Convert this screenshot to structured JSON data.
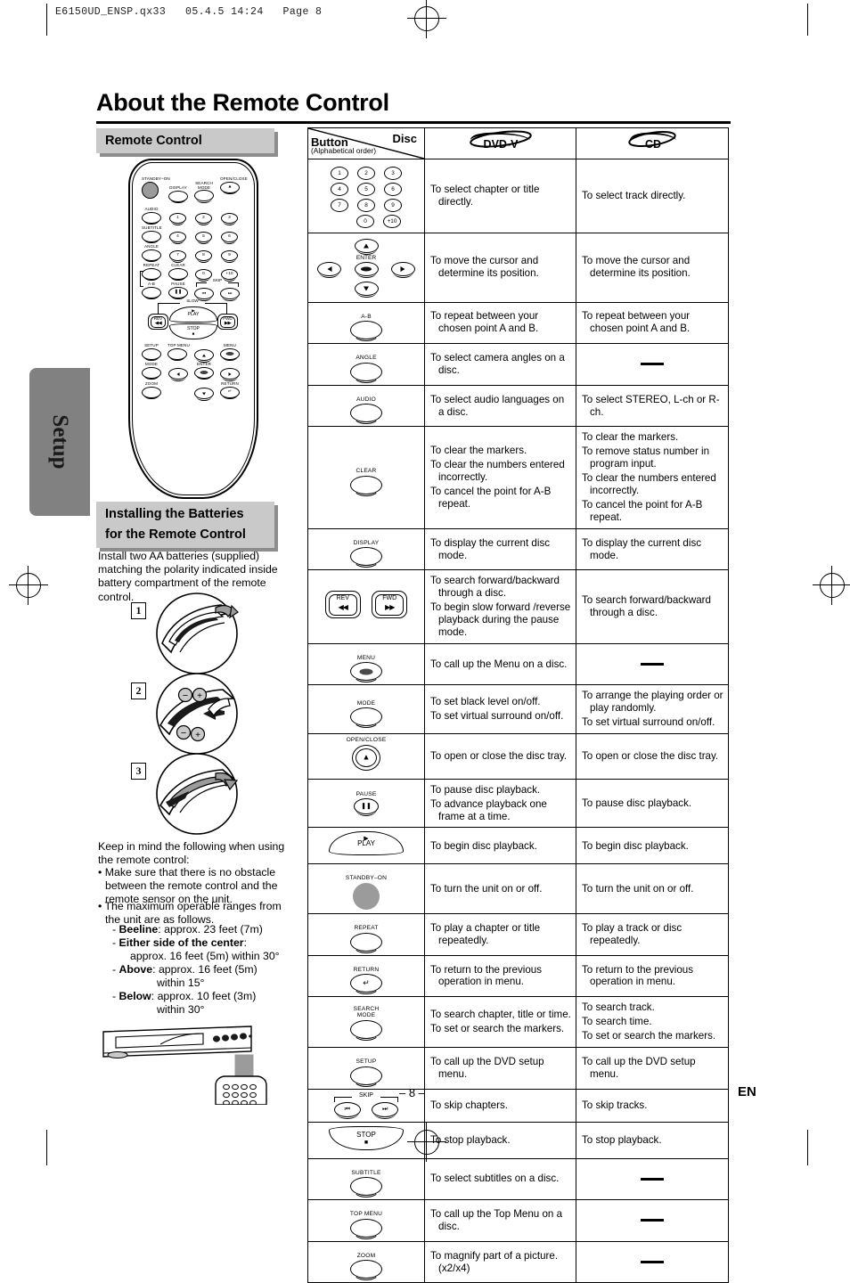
{
  "meta": {
    "file_stamp": "E6150UD_ENSP.qx33   05.4.5 14:24   Page 8",
    "page_number": "– 8 –",
    "language_code": "EN",
    "side_tab": "Setup"
  },
  "page_title": "About the Remote Control",
  "sections": {
    "remote_control": "Remote Control",
    "installing_batteries_line1": "Installing the Batteries",
    "installing_batteries_line2": "for the Remote Control"
  },
  "battery_instructions": {
    "intro": "Install two AA batteries (supplied) matching the polarity indicated inside battery compartment of the remote control.",
    "steps": [
      "1",
      "2",
      "3"
    ]
  },
  "keep_in_mind": {
    "heading": "Keep in mind the following when using the remote control:",
    "bullets": [
      "Make sure that there is no obstacle between the remote control and the remote sensor on the unit.",
      "The maximum operable ranges from the unit are as follows."
    ],
    "ranges": [
      {
        "label": "Beeline",
        "value": ": approx. 23 feet (7m)"
      },
      {
        "label": "Either side of the center",
        "value": ":",
        "value2": "approx. 16 feet (5m) within 30°"
      },
      {
        "label": "Above",
        "value": ":  approx. 16 feet (5m)",
        "value2": "within 15°"
      },
      {
        "label": "Below",
        "value": ":  approx. 10 feet (3m)",
        "value2": "within 30°"
      }
    ]
  },
  "table": {
    "header": {
      "button": "Button",
      "button_sub": "(Alphabetical order)",
      "disc": "Disc",
      "dvd_logo": "DVD-V",
      "cd_logo": "CD"
    },
    "rows": [
      {
        "key": "numbers",
        "key_label": "",
        "dvd": [
          "To select chapter or title directly."
        ],
        "cd": [
          "To select track directly."
        ]
      },
      {
        "key": "cursor-enter",
        "key_label": "ENTER",
        "dvd": [
          "To move the cursor and determine its position."
        ],
        "cd": [
          "To move the cursor and determine its position."
        ]
      },
      {
        "key": "a-b",
        "key_label": "A-B",
        "dvd": [
          "To repeat between your chosen point A and B."
        ],
        "cd": [
          "To repeat between your chosen point A and B."
        ]
      },
      {
        "key": "angle",
        "key_label": "ANGLE",
        "dvd": [
          "To select camera angles on a disc."
        ],
        "cd": []
      },
      {
        "key": "audio",
        "key_label": "AUDIO",
        "dvd": [
          "To select audio languages on a disc."
        ],
        "cd": [
          "To select STEREO, L-ch or R-ch."
        ]
      },
      {
        "key": "clear",
        "key_label": "CLEAR",
        "dvd": [
          "To clear the markers.",
          "To clear the numbers entered incorrectly.",
          "To cancel the point for A-B repeat."
        ],
        "cd": [
          "To clear the markers.",
          "To remove status number in program input.",
          "To clear the numbers entered incorrectly.",
          "To cancel the point for A-B repeat."
        ]
      },
      {
        "key": "display",
        "key_label": "DISPLAY",
        "dvd": [
          "To display the current disc mode."
        ],
        "cd": [
          "To display the current disc mode."
        ]
      },
      {
        "key": "rev-fwd",
        "key_label": "REV / FWD",
        "dvd": [
          "To search forward/backward through a disc.",
          "To begin slow forward /reverse playback during the pause mode."
        ],
        "cd": [
          "To search forward/backward through a disc."
        ]
      },
      {
        "key": "menu",
        "key_label": "MENU",
        "dvd": [
          "To call up the Menu on a disc."
        ],
        "cd": []
      },
      {
        "key": "mode",
        "key_label": "MODE",
        "dvd": [
          "To set black level on/off.",
          "To set virtual surround on/off."
        ],
        "cd": [
          "To arrange the playing order or play randomly.",
          "To set virtual surround on/off."
        ]
      },
      {
        "key": "open-close",
        "key_label": "OPEN/CLOSE",
        "dvd": [
          "To open or close the disc tray."
        ],
        "cd": [
          "To open or close the disc tray."
        ]
      },
      {
        "key": "pause",
        "key_label": "PAUSE",
        "dvd": [
          "To pause disc playback.",
          "To advance playback one frame at a time."
        ],
        "cd": [
          "To pause disc playback."
        ]
      },
      {
        "key": "play",
        "key_label": "PLAY",
        "dvd": [
          "To begin disc playback."
        ],
        "cd": [
          "To begin disc playback."
        ]
      },
      {
        "key": "standby-on",
        "key_label": "STANDBY–ON",
        "dvd": [
          "To turn the unit on or off."
        ],
        "cd": [
          "To turn the unit on or off."
        ]
      },
      {
        "key": "repeat",
        "key_label": "REPEAT",
        "dvd": [
          "To play a chapter or title repeatedly."
        ],
        "cd": [
          "To play a track or disc repeatedly."
        ]
      },
      {
        "key": "return",
        "key_label": "RETURN",
        "dvd": [
          "To return to the previous operation in menu."
        ],
        "cd": [
          "To return to the previous operation in menu."
        ]
      },
      {
        "key": "search-mode",
        "key_label": "SEARCH MODE",
        "dvd": [
          "To search chapter, title or time.",
          "To set or search the markers."
        ],
        "cd": [
          "To search track.",
          "To search time.",
          "To set or search the markers."
        ]
      },
      {
        "key": "setup",
        "key_label": "SETUP",
        "dvd": [
          "To call up the DVD setup menu."
        ],
        "cd": [
          "To call up the DVD setup menu."
        ]
      },
      {
        "key": "skip",
        "key_label": "SKIP",
        "dvd": [
          "To skip chapters."
        ],
        "cd": [
          "To skip tracks."
        ]
      },
      {
        "key": "stop",
        "key_label": "STOP",
        "dvd": [
          "To stop playback."
        ],
        "cd": [
          "To stop playback."
        ]
      },
      {
        "key": "subtitle",
        "key_label": "SUBTITLE",
        "dvd": [
          "To select subtitles on a disc."
        ],
        "cd": []
      },
      {
        "key": "top-menu",
        "key_label": "TOP MENU",
        "dvd": [
          "To call up the Top Menu on a disc."
        ],
        "cd": []
      },
      {
        "key": "zoom",
        "key_label": "ZOOM",
        "dvd": [
          "To magnify part of a picture. (x2/x4)"
        ],
        "cd": []
      }
    ],
    "numeric_keys": [
      "1",
      "2",
      "3",
      "4",
      "5",
      "6",
      "7",
      "8",
      "9",
      "0",
      "+10"
    ]
  },
  "remote_illustration": {
    "labels": {
      "standby_on": "STANDBY–ON",
      "display": "DISPLAY",
      "search_mode_1": "SEARCH",
      "search_mode_2": "MODE",
      "open_close": "OPEN/CLOSE",
      "audio": "AUDIO",
      "subtitle": "SUBTITLE",
      "angle": "ANGLE",
      "repeat": "REPEAT",
      "clear": "CLEAR",
      "a_b": "A-B",
      "pause": "PAUSE",
      "skip": "SKIP",
      "slow": "SLOW",
      "play": "PLAY",
      "stop": "STOP",
      "rev": "REV",
      "fwd": "FWD",
      "setup": "SETUP",
      "top_menu": "TOP MENU",
      "menu": "MENU",
      "mode": "MODE",
      "enter": "ENTER",
      "zoom": "ZOOM",
      "return": "RETURN"
    },
    "numbers": [
      "1",
      "2",
      "3",
      "4",
      "5",
      "6",
      "7",
      "8",
      "9",
      "0",
      "+10"
    ]
  },
  "colors": {
    "section_bar": "#c9c9c9",
    "section_shadow": "#8d8d8d",
    "side_tab": "#818181",
    "standby_key": "#9b9b9b",
    "text": "#000000"
  }
}
